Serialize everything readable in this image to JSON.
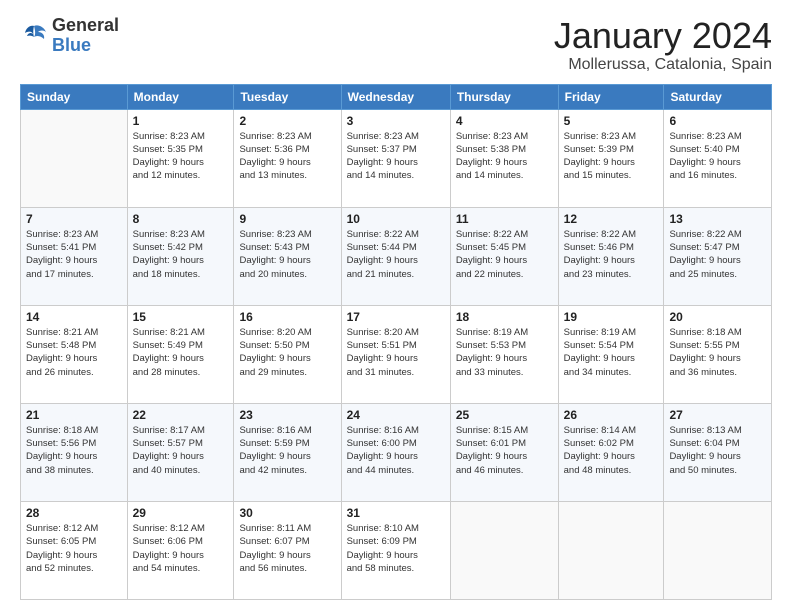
{
  "logo": {
    "general": "General",
    "blue": "Blue"
  },
  "header": {
    "month": "January 2024",
    "location": "Mollerussa, Catalonia, Spain"
  },
  "days_of_week": [
    "Sunday",
    "Monday",
    "Tuesday",
    "Wednesday",
    "Thursday",
    "Friday",
    "Saturday"
  ],
  "weeks": [
    [
      {
        "day": "",
        "info": ""
      },
      {
        "day": "1",
        "info": "Sunrise: 8:23 AM\nSunset: 5:35 PM\nDaylight: 9 hours\nand 12 minutes."
      },
      {
        "day": "2",
        "info": "Sunrise: 8:23 AM\nSunset: 5:36 PM\nDaylight: 9 hours\nand 13 minutes."
      },
      {
        "day": "3",
        "info": "Sunrise: 8:23 AM\nSunset: 5:37 PM\nDaylight: 9 hours\nand 14 minutes."
      },
      {
        "day": "4",
        "info": "Sunrise: 8:23 AM\nSunset: 5:38 PM\nDaylight: 9 hours\nand 14 minutes."
      },
      {
        "day": "5",
        "info": "Sunrise: 8:23 AM\nSunset: 5:39 PM\nDaylight: 9 hours\nand 15 minutes."
      },
      {
        "day": "6",
        "info": "Sunrise: 8:23 AM\nSunset: 5:40 PM\nDaylight: 9 hours\nand 16 minutes."
      }
    ],
    [
      {
        "day": "7",
        "info": "Sunrise: 8:23 AM\nSunset: 5:41 PM\nDaylight: 9 hours\nand 17 minutes."
      },
      {
        "day": "8",
        "info": "Sunrise: 8:23 AM\nSunset: 5:42 PM\nDaylight: 9 hours\nand 18 minutes."
      },
      {
        "day": "9",
        "info": "Sunrise: 8:23 AM\nSunset: 5:43 PM\nDaylight: 9 hours\nand 20 minutes."
      },
      {
        "day": "10",
        "info": "Sunrise: 8:22 AM\nSunset: 5:44 PM\nDaylight: 9 hours\nand 21 minutes."
      },
      {
        "day": "11",
        "info": "Sunrise: 8:22 AM\nSunset: 5:45 PM\nDaylight: 9 hours\nand 22 minutes."
      },
      {
        "day": "12",
        "info": "Sunrise: 8:22 AM\nSunset: 5:46 PM\nDaylight: 9 hours\nand 23 minutes."
      },
      {
        "day": "13",
        "info": "Sunrise: 8:22 AM\nSunset: 5:47 PM\nDaylight: 9 hours\nand 25 minutes."
      }
    ],
    [
      {
        "day": "14",
        "info": "Sunrise: 8:21 AM\nSunset: 5:48 PM\nDaylight: 9 hours\nand 26 minutes."
      },
      {
        "day": "15",
        "info": "Sunrise: 8:21 AM\nSunset: 5:49 PM\nDaylight: 9 hours\nand 28 minutes."
      },
      {
        "day": "16",
        "info": "Sunrise: 8:20 AM\nSunset: 5:50 PM\nDaylight: 9 hours\nand 29 minutes."
      },
      {
        "day": "17",
        "info": "Sunrise: 8:20 AM\nSunset: 5:51 PM\nDaylight: 9 hours\nand 31 minutes."
      },
      {
        "day": "18",
        "info": "Sunrise: 8:19 AM\nSunset: 5:53 PM\nDaylight: 9 hours\nand 33 minutes."
      },
      {
        "day": "19",
        "info": "Sunrise: 8:19 AM\nSunset: 5:54 PM\nDaylight: 9 hours\nand 34 minutes."
      },
      {
        "day": "20",
        "info": "Sunrise: 8:18 AM\nSunset: 5:55 PM\nDaylight: 9 hours\nand 36 minutes."
      }
    ],
    [
      {
        "day": "21",
        "info": "Sunrise: 8:18 AM\nSunset: 5:56 PM\nDaylight: 9 hours\nand 38 minutes."
      },
      {
        "day": "22",
        "info": "Sunrise: 8:17 AM\nSunset: 5:57 PM\nDaylight: 9 hours\nand 40 minutes."
      },
      {
        "day": "23",
        "info": "Sunrise: 8:16 AM\nSunset: 5:59 PM\nDaylight: 9 hours\nand 42 minutes."
      },
      {
        "day": "24",
        "info": "Sunrise: 8:16 AM\nSunset: 6:00 PM\nDaylight: 9 hours\nand 44 minutes."
      },
      {
        "day": "25",
        "info": "Sunrise: 8:15 AM\nSunset: 6:01 PM\nDaylight: 9 hours\nand 46 minutes."
      },
      {
        "day": "26",
        "info": "Sunrise: 8:14 AM\nSunset: 6:02 PM\nDaylight: 9 hours\nand 48 minutes."
      },
      {
        "day": "27",
        "info": "Sunrise: 8:13 AM\nSunset: 6:04 PM\nDaylight: 9 hours\nand 50 minutes."
      }
    ],
    [
      {
        "day": "28",
        "info": "Sunrise: 8:12 AM\nSunset: 6:05 PM\nDaylight: 9 hours\nand 52 minutes."
      },
      {
        "day": "29",
        "info": "Sunrise: 8:12 AM\nSunset: 6:06 PM\nDaylight: 9 hours\nand 54 minutes."
      },
      {
        "day": "30",
        "info": "Sunrise: 8:11 AM\nSunset: 6:07 PM\nDaylight: 9 hours\nand 56 minutes."
      },
      {
        "day": "31",
        "info": "Sunrise: 8:10 AM\nSunset: 6:09 PM\nDaylight: 9 hours\nand 58 minutes."
      },
      {
        "day": "",
        "info": ""
      },
      {
        "day": "",
        "info": ""
      },
      {
        "day": "",
        "info": ""
      }
    ]
  ]
}
